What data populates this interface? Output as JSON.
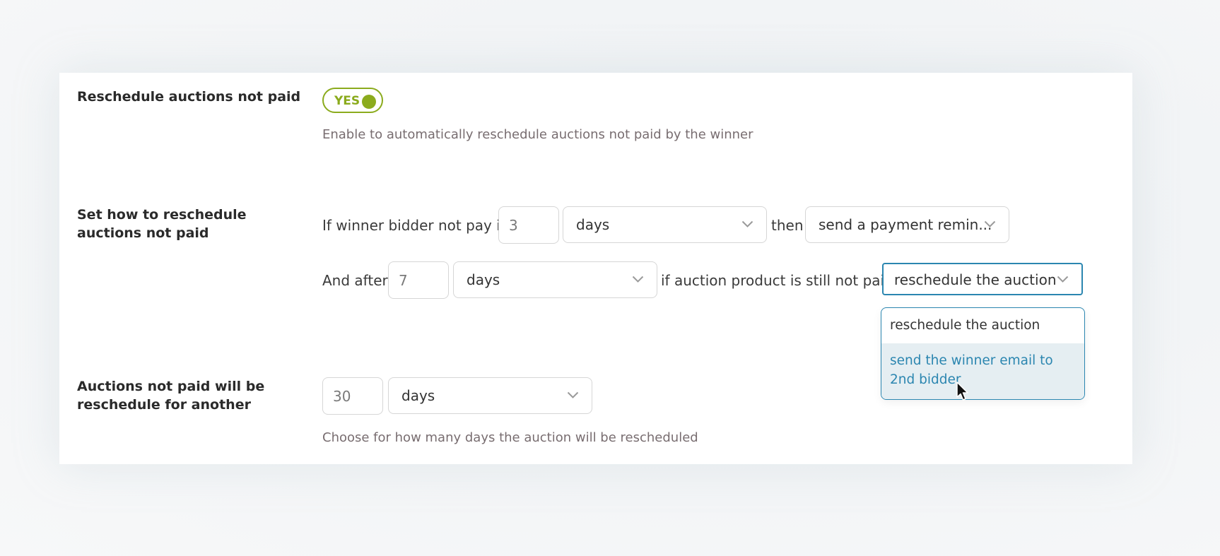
{
  "settings": {
    "reschedule_not_paid": {
      "label": "Reschedule auctions not paid",
      "toggle": "YES",
      "description": "Enable to automatically reschedule auctions not paid by the winner"
    },
    "how_to_reschedule": {
      "label_line1": "Set how to reschedule",
      "label_line2": "auctions not paid",
      "row1": {
        "prefix": "If winner bidder not pay in",
        "amount": "3",
        "unit": "days",
        "connector": "then",
        "action": "send a payment remin..."
      },
      "row2": {
        "prefix": "And after",
        "amount": "7",
        "unit": "days",
        "connector": "if auction product is still not paid",
        "action": "reschedule the auction"
      },
      "dropdown_options": [
        "reschedule the auction",
        "send the winner email to 2nd bidder"
      ]
    },
    "reschedule_for": {
      "label_line1": "Auctions not paid will be",
      "label_line2": "reschedule for another",
      "amount": "30",
      "unit": "days",
      "description": "Choose for how many days the auction will be rescheduled"
    }
  },
  "colors": {
    "toggle_green": "#8bab1d",
    "focus_blue": "#2b86b0",
    "highlight_bg": "#e5eef2",
    "desc_text": "#786d70"
  },
  "icons": {
    "select_arrow": "chevron-down-icon",
    "pointer": "mouse-cursor-icon"
  }
}
